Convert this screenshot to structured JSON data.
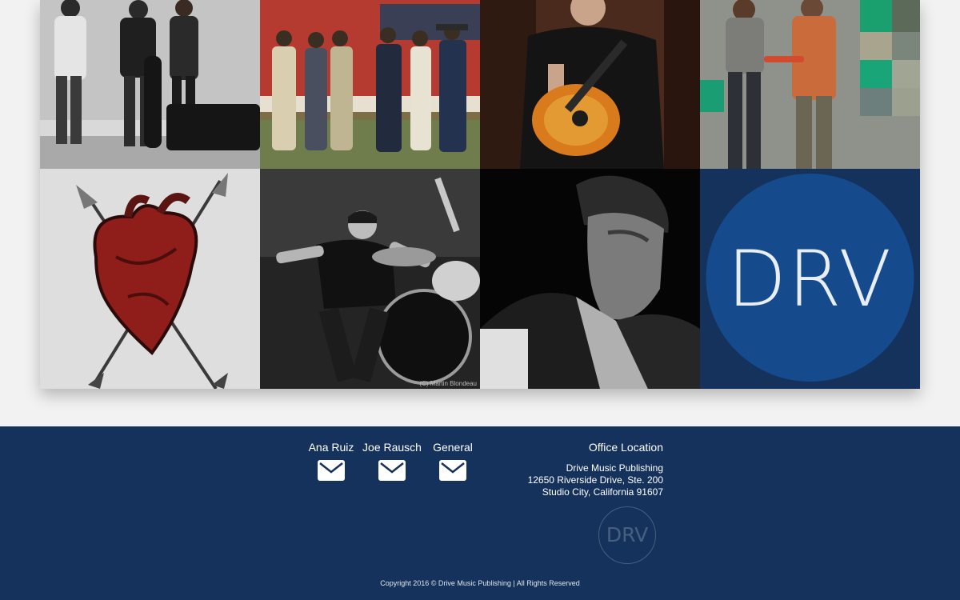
{
  "gallery": {
    "tiles": [
      {
        "name": "artist-photo-1"
      },
      {
        "name": "artist-photo-2"
      },
      {
        "name": "artist-photo-3"
      },
      {
        "name": "artist-photo-4"
      },
      {
        "name": "artist-photo-5"
      },
      {
        "name": "artist-photo-6",
        "credit": "(C) Martin Blondeau"
      },
      {
        "name": "artist-photo-7"
      },
      {
        "name": "drv-logo-tile",
        "logo_text": "DRV"
      }
    ]
  },
  "footer": {
    "contacts": [
      {
        "label": "Ana Ruiz",
        "icon": "envelope-icon"
      },
      {
        "label": "Joe Rausch",
        "icon": "envelope-icon"
      },
      {
        "label": "General",
        "icon": "envelope-icon"
      }
    ],
    "office": {
      "title": "Office Location",
      "company": "Drive Music Publishing",
      "street": "12650 Riverside Drive, Ste. 200",
      "city": "Studio City, California 91607"
    },
    "logo_text": "DRV",
    "copyright": "Copyright 2016 © Drive Music Publishing | All Rights Reserved"
  },
  "colors": {
    "footer_bg": "#14325b",
    "logo_circle": "#154a8c",
    "page_bg": "#f2f2f2"
  }
}
